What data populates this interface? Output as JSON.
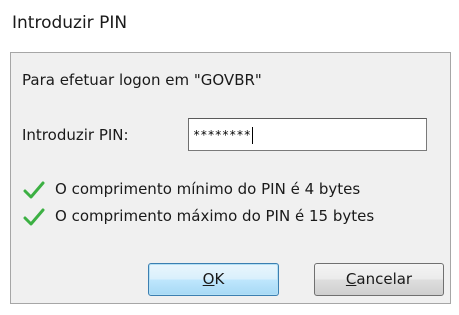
{
  "dialog": {
    "title": "Introduzir PIN",
    "logon_text": "Para efetuar logon em \"GOVBR\"",
    "pin_label": "Introduzir PIN:",
    "pin_value": "********",
    "requirements": [
      {
        "text": "O comprimento mínimo do PIN é 4 bytes",
        "icon": "green-check-icon",
        "met": true
      },
      {
        "text": "O comprimento máximo do PIN é 15 bytes",
        "icon": "green-check-icon",
        "met": true
      }
    ],
    "ok_label": "OK",
    "ok_mnemonic": "O",
    "ok_rest": "K",
    "cancel_label": "Cancelar",
    "cancel_mnemonic": "C",
    "cancel_rest": "ancelar"
  },
  "colors": {
    "check_green": "#3cb043",
    "default_button_border": "#3c7fb1"
  }
}
